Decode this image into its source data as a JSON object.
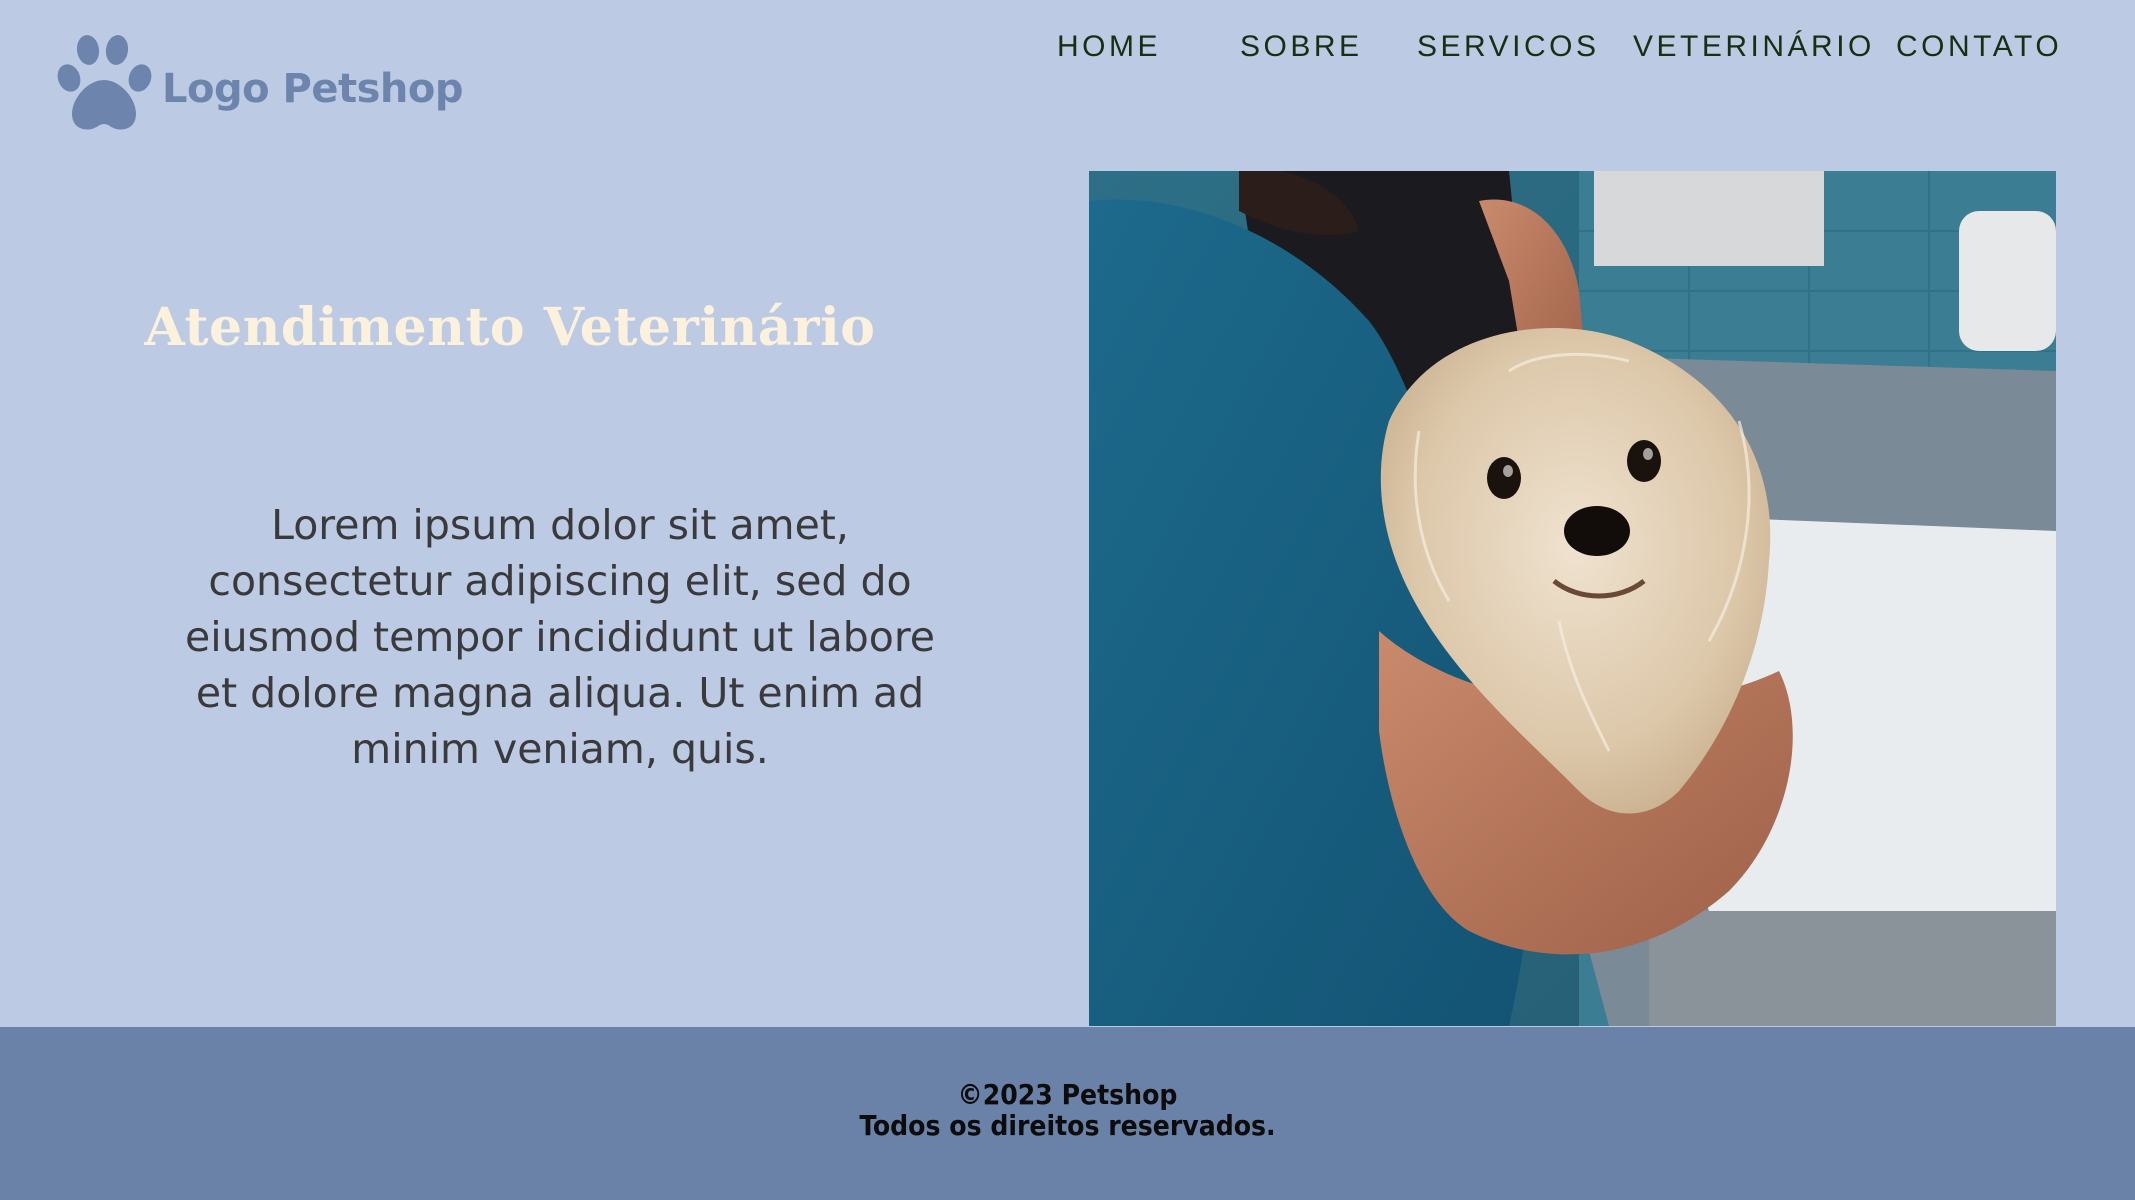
{
  "brand": {
    "logo_text": "Logo Petshop",
    "logo_icon": "paw-icon",
    "accent_color": "#6d85ad"
  },
  "nav": {
    "items": [
      {
        "label": "HOME"
      },
      {
        "label": "SOBRE"
      },
      {
        "label": "SERVICOS"
      },
      {
        "label": "VETERINÁRIO"
      },
      {
        "label": "CONTATO"
      }
    ]
  },
  "hero": {
    "title": "Atendimento Veterinário",
    "body": "Lorem ipsum dolor sit amet, consectetur adipiscing elit, sed do eiusmod tempor incididunt ut labore et dolore magna aliqua. Ut enim ad minim veniam, quis.",
    "photo_subject": "veterinarian holding a small white dog"
  },
  "footer": {
    "copyright": "©2023 Petshop",
    "rights": "Todos os direitos reservados."
  },
  "colors": {
    "background": "#bccbe3",
    "footer_background": "#6a82a8",
    "title_color": "#fcf1dd",
    "nav_color": "#1a2e12"
  }
}
